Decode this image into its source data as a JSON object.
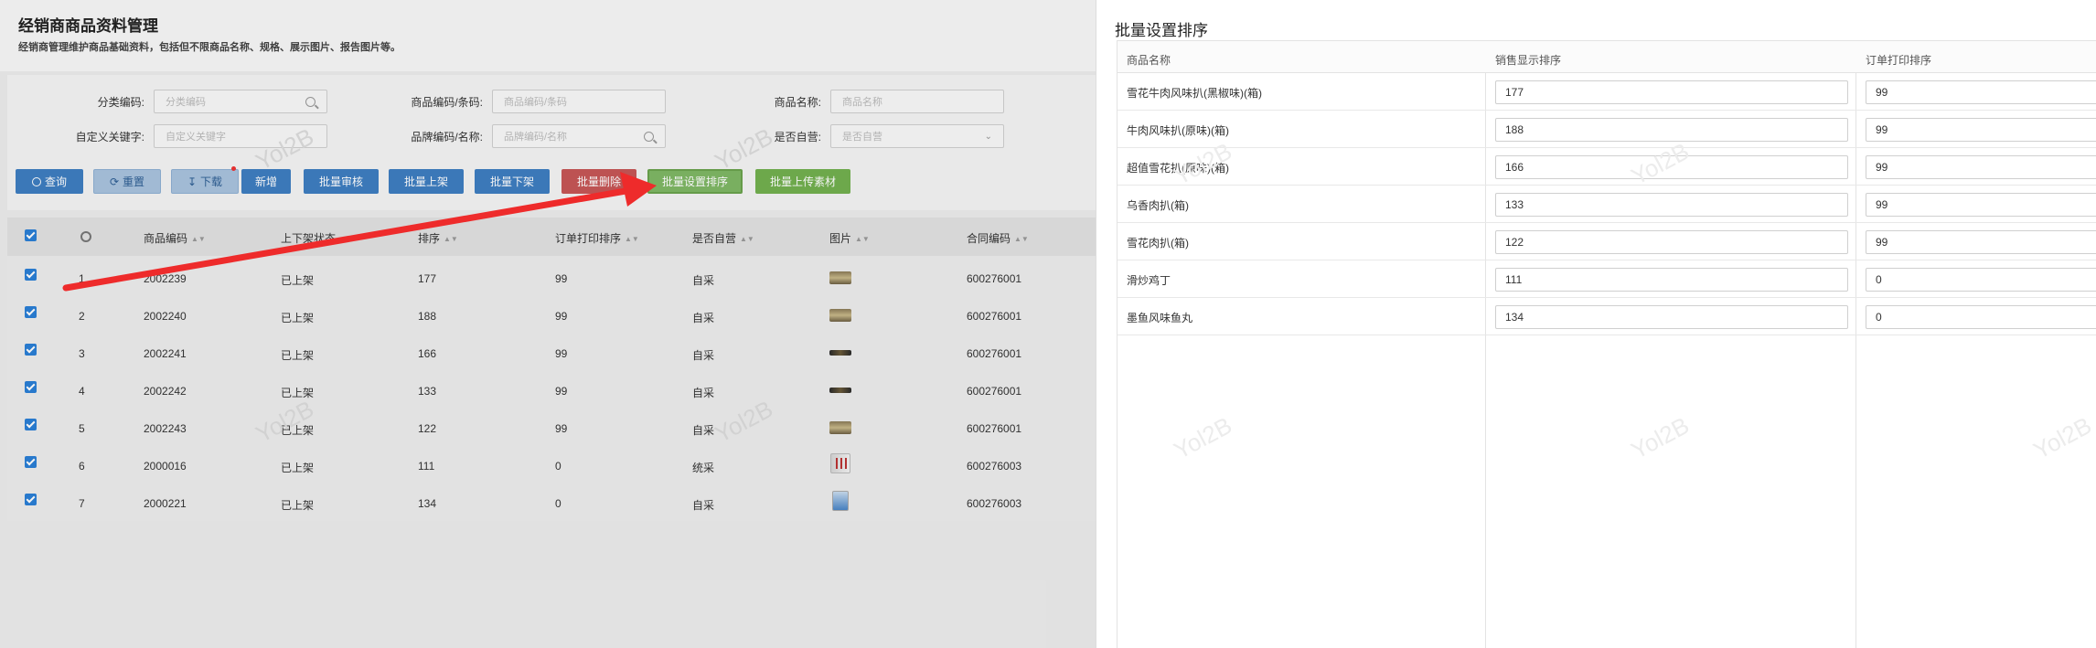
{
  "page": {
    "title": "经销商商品资料管理",
    "subtitle": "经销商管理维护商品基础资料，包括但不限商品名称、规格、展示图片、报告图片等。"
  },
  "filters": {
    "category_code": {
      "label": "分类编码:",
      "placeholder": "分类编码"
    },
    "product_code": {
      "label": "商品编码/条码:",
      "placeholder": "商品编码/条码"
    },
    "product_name": {
      "label": "商品名称:",
      "placeholder": "商品名称"
    },
    "custom_keyword": {
      "label": "自定义关键字:",
      "placeholder": "自定义关键字"
    },
    "brand_code": {
      "label": "品牌编码/名称:",
      "placeholder": "品牌编码/名称"
    },
    "self_operated": {
      "label": "是否自营:",
      "placeholder": "是否自营"
    }
  },
  "toolbar": {
    "query": "查询",
    "reset": "重置",
    "download": "下载",
    "add": "新增",
    "batch_review": "批量审核",
    "batch_list": "批量上架",
    "batch_delist": "批量下架",
    "batch_delete": "批量删除",
    "batch_sort": "批量设置排序",
    "batch_upload": "批量上传素材"
  },
  "grid": {
    "columns": [
      "商品编码",
      "上下架状态",
      "排序",
      "订单打印排序",
      "是否自营",
      "图片",
      "合同编码"
    ],
    "rows": [
      {
        "no": "1",
        "code": "2002239",
        "status": "已上架",
        "sort": "177",
        "print_sort": "99",
        "self": "自采",
        "image": "box",
        "contract": "600276001"
      },
      {
        "no": "2",
        "code": "2002240",
        "status": "已上架",
        "sort": "188",
        "print_sort": "99",
        "self": "自采",
        "image": "box",
        "contract": "600276001"
      },
      {
        "no": "3",
        "code": "2002241",
        "status": "已上架",
        "sort": "166",
        "print_sort": "99",
        "self": "自采",
        "image": "stick",
        "contract": "600276001"
      },
      {
        "no": "4",
        "code": "2002242",
        "status": "已上架",
        "sort": "133",
        "print_sort": "99",
        "self": "自采",
        "image": "stick",
        "contract": "600276001"
      },
      {
        "no": "5",
        "code": "2002243",
        "status": "已上架",
        "sort": "122",
        "print_sort": "99",
        "self": "自采",
        "image": "box",
        "contract": "600276001"
      },
      {
        "no": "6",
        "code": "2000016",
        "status": "已上架",
        "sort": "111",
        "print_sort": "0",
        "self": "统采",
        "image": "bag",
        "contract": "600276003"
      },
      {
        "no": "7",
        "code": "2000221",
        "status": "已上架",
        "sort": "134",
        "print_sort": "0",
        "self": "自采",
        "image": "pack",
        "contract": "600276003"
      }
    ]
  },
  "watermark": "Yol2B",
  "modal": {
    "title": "批量设置排序",
    "headers": [
      "商品名称",
      "销售显示排序",
      "订单打印排序"
    ],
    "rows": [
      {
        "name": "雪花牛肉风味扒(黑椒味)(箱)",
        "sale_sort": "177",
        "print_sort": "99"
      },
      {
        "name": "牛肉风味扒(原味)(箱)",
        "sale_sort": "188",
        "print_sort": "99"
      },
      {
        "name": "超值雪花扒(原味)(箱)",
        "sale_sort": "166",
        "print_sort": "99"
      },
      {
        "name": "乌香肉扒(箱)",
        "sale_sort": "133",
        "print_sort": "99"
      },
      {
        "name": "雪花肉扒(箱)",
        "sale_sort": "122",
        "print_sort": "99"
      },
      {
        "name": "滑炒鸡丁",
        "sale_sort": "111",
        "print_sort": "0"
      },
      {
        "name": "墨鱼风味鱼丸",
        "sale_sort": "134",
        "print_sort": "0"
      }
    ]
  },
  "colors": {
    "primary": "#3e7ec1",
    "danger": "#c65656",
    "success": "#72b04f",
    "arrow": "#ee2b2b"
  }
}
